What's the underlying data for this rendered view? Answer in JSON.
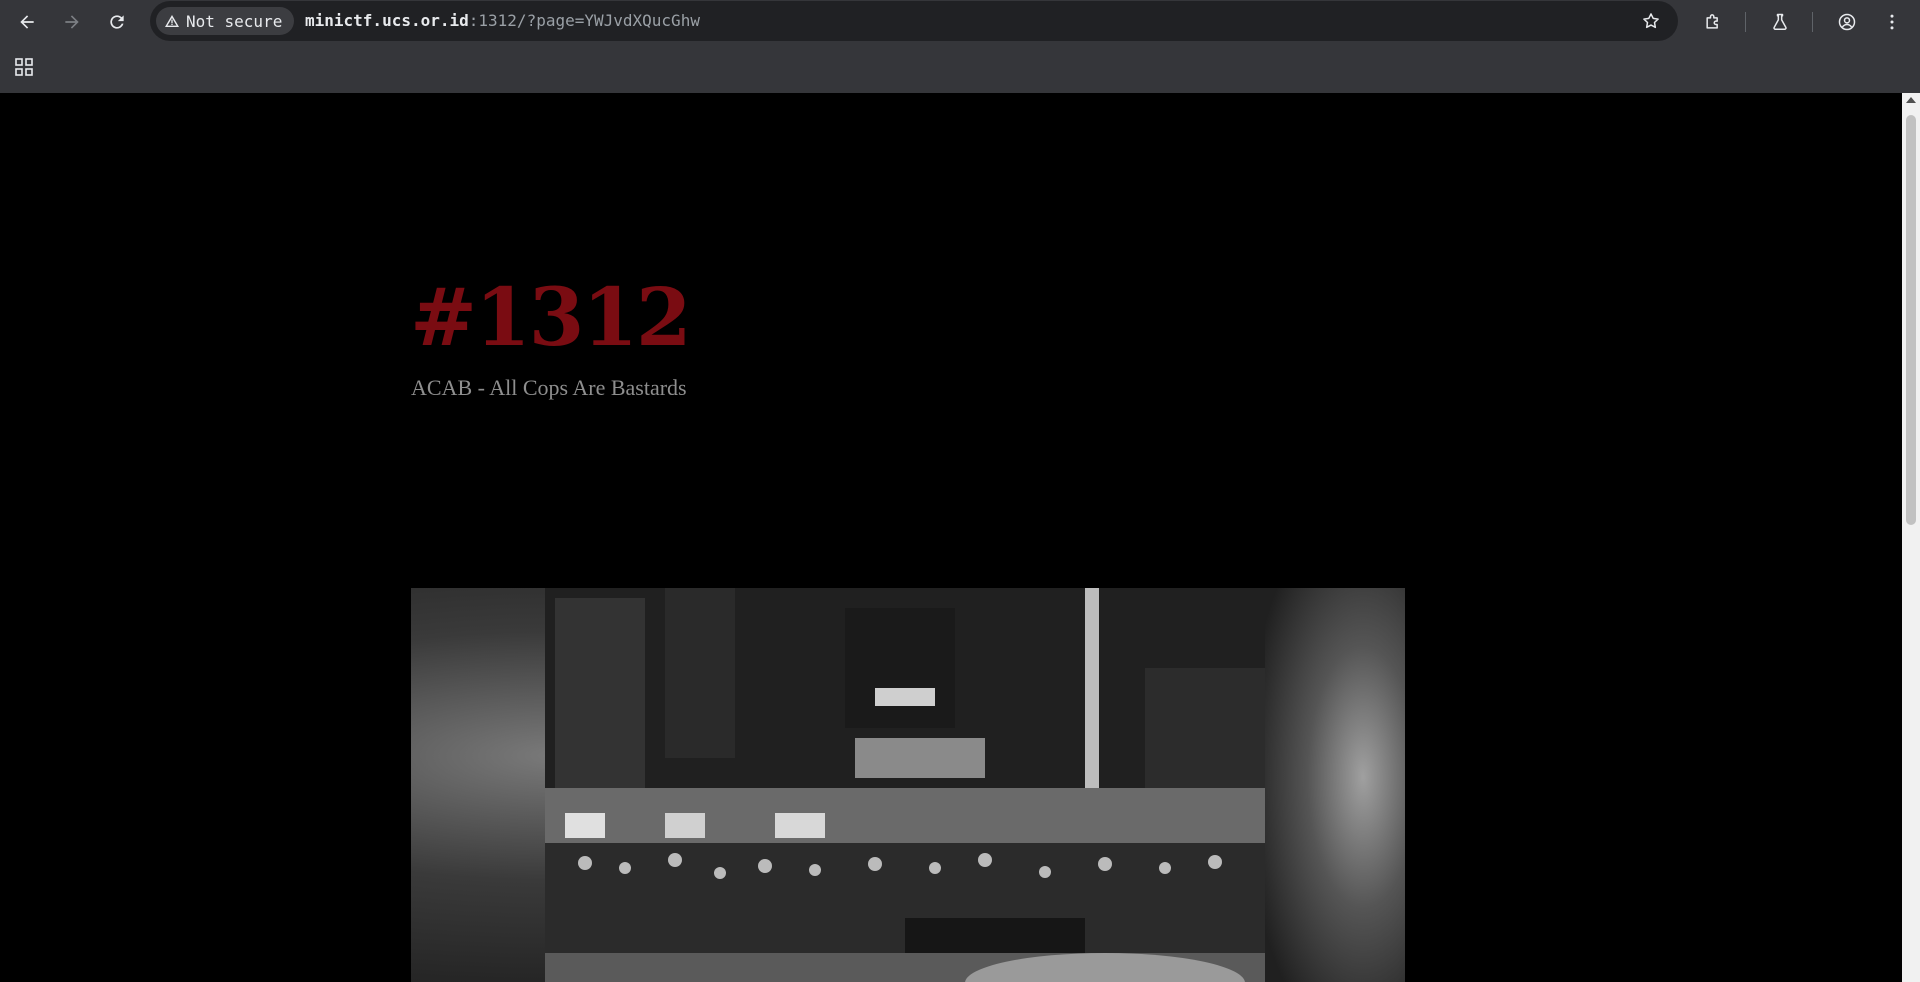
{
  "browser": {
    "security_chip": "Not secure",
    "url_host": "minictf.ucs.or.id",
    "url_rest": ":1312/?page=YWJvdXQucGhw",
    "icons": [
      "back-icon",
      "forward-icon",
      "reload-icon",
      "warning-icon",
      "star-icon",
      "extensions-icon",
      "labs-icon",
      "profile-icon",
      "menu-icon",
      "apps-icon"
    ]
  },
  "page": {
    "title": "#1312",
    "subtitle": "ACAB - All Cops Are Bastards"
  },
  "colors": {
    "title": "#7a0c12",
    "subtitle": "#8e8e8e",
    "background": "#000000",
    "chrome": "#35363a",
    "omnibox": "#202124"
  }
}
